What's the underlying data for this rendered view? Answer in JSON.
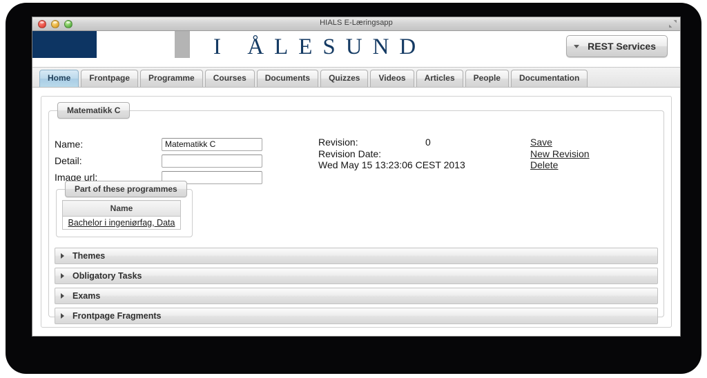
{
  "window": {
    "title": "HIALS E-Læringsapp",
    "controls": {
      "close": "close",
      "minimize": "minimize",
      "zoom": "zoom"
    }
  },
  "brand": {
    "wordmark": "I ÅLESUND",
    "logo_color": "#0d3563",
    "accent_color": "#b4b4b4",
    "rest_button": "REST Services"
  },
  "tabs": [
    {
      "label": "Home",
      "active": true
    },
    {
      "label": "Frontpage",
      "active": false
    },
    {
      "label": "Programme",
      "active": false
    },
    {
      "label": "Courses",
      "active": false
    },
    {
      "label": "Documents",
      "active": false
    },
    {
      "label": "Quizzes",
      "active": false
    },
    {
      "label": "Videos",
      "active": false
    },
    {
      "label": "Articles",
      "active": false
    },
    {
      "label": "People",
      "active": false
    },
    {
      "label": "Documentation",
      "active": false
    }
  ],
  "course": {
    "legend": "Matematikk C",
    "fields": [
      {
        "label": "Name:",
        "value": "Matematikk C",
        "placeholder": ""
      },
      {
        "label": "Detail:",
        "value": "",
        "placeholder": ""
      },
      {
        "label": "Image url:",
        "value": "",
        "placeholder": ""
      }
    ],
    "revision": {
      "revision_label": "Revision:",
      "revision_value": "0",
      "date_label": "Revision Date:",
      "date_value": "Wed May 15 13:23:06 CEST 2013"
    },
    "actions": [
      {
        "label": "Save"
      },
      {
        "label": "New Revision"
      },
      {
        "label": "Delete"
      }
    ],
    "programmes": {
      "legend": "Part of these programmes",
      "columns": [
        "Name"
      ],
      "rows": [
        [
          "Bachelor i ingeniørfag, Data"
        ]
      ]
    },
    "sections": [
      {
        "label": "Themes",
        "expanded": false
      },
      {
        "label": "Obligatory Tasks",
        "expanded": false
      },
      {
        "label": "Exams",
        "expanded": false
      },
      {
        "label": "Frontpage Fragments",
        "expanded": false
      }
    ]
  }
}
